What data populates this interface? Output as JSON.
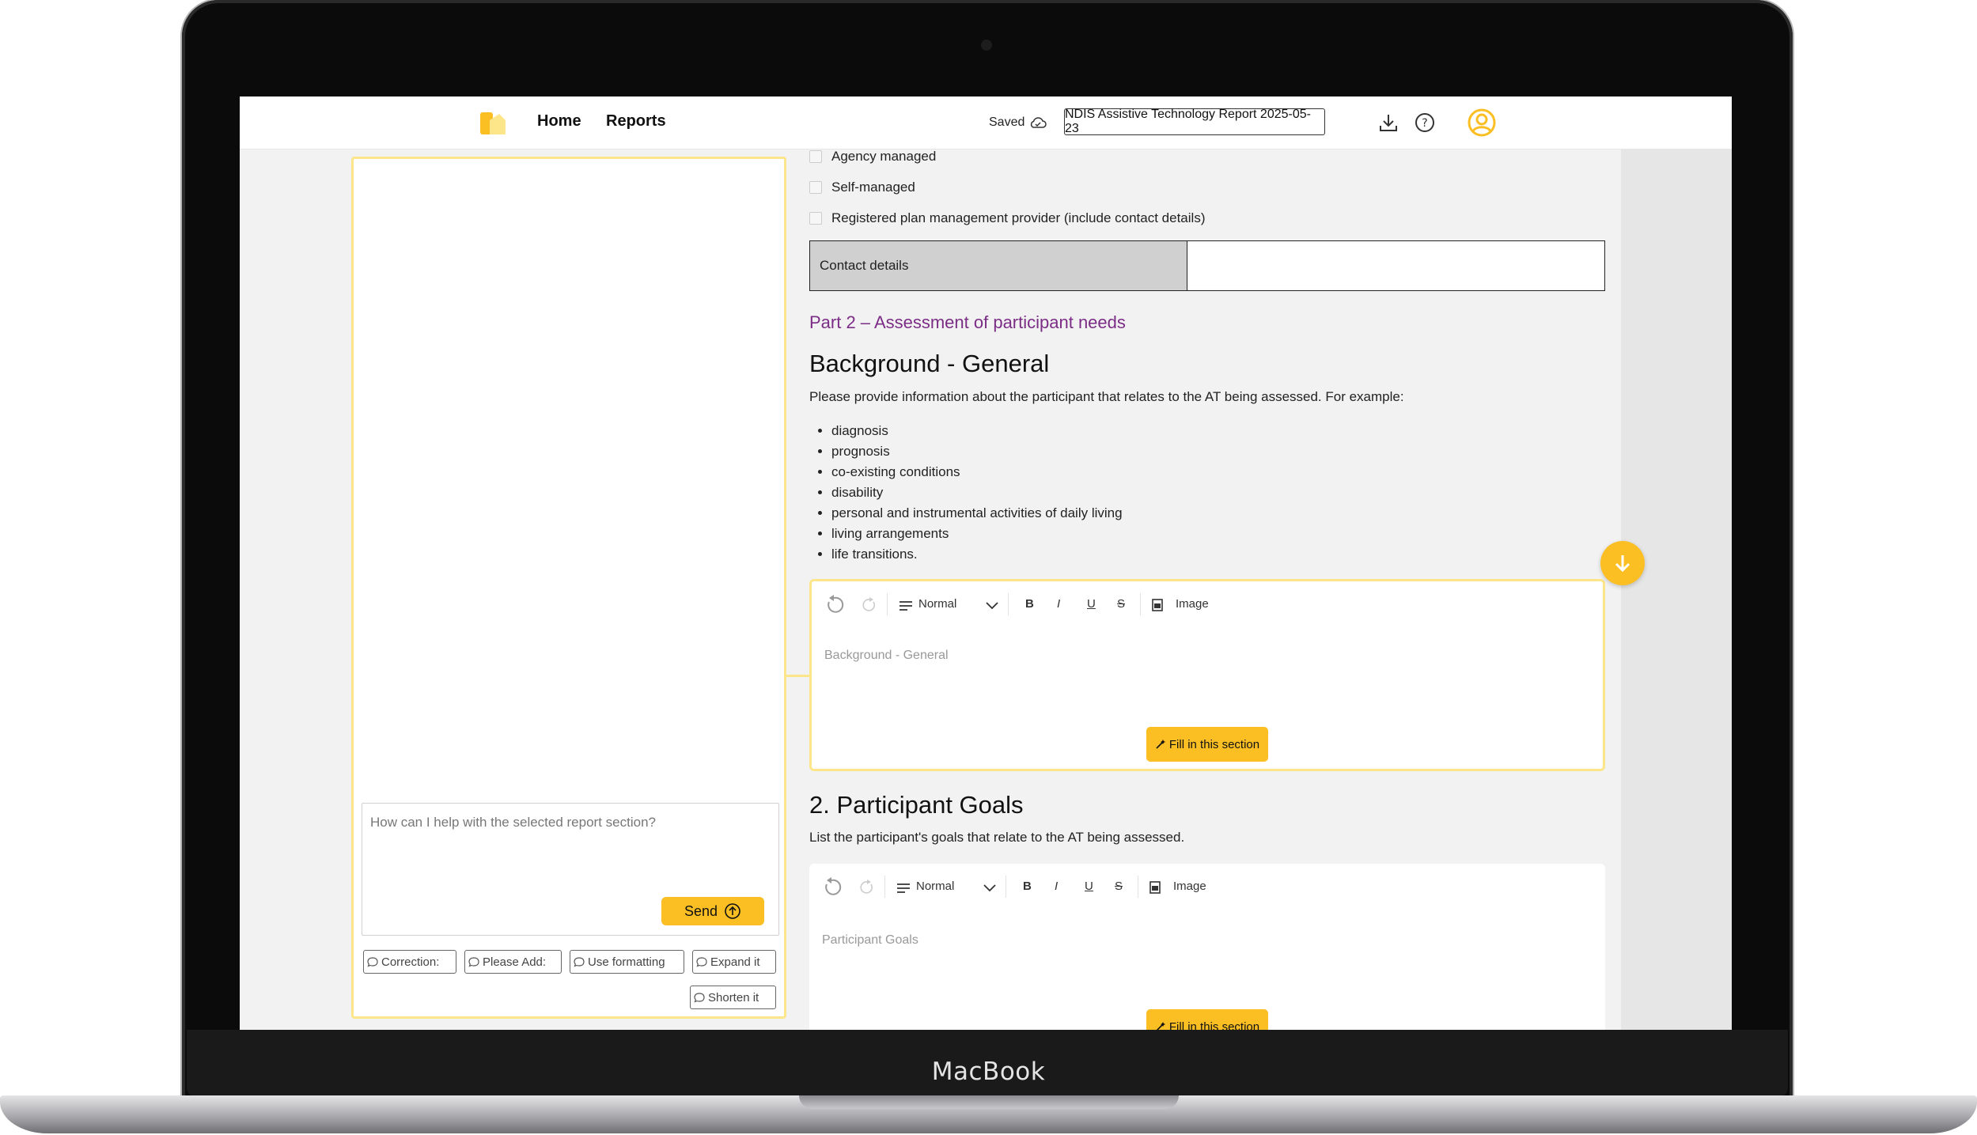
{
  "device": {
    "brand": "MacBook"
  },
  "header": {
    "nav": [
      "Home",
      "Reports"
    ],
    "saved_label": "Saved",
    "report_title": "NDIS Assistive Technology Report 2025-05-23"
  },
  "chat": {
    "placeholder": "How can I help with the selected report section?",
    "send_label": "Send",
    "chips": [
      "Correction:",
      "Please Add:",
      "Use formatting",
      "Expand it",
      "Shorten it"
    ]
  },
  "report": {
    "checkboxes": [
      "Agency managed",
      "Self-managed",
      "Registered plan management provider (include contact details)"
    ],
    "contact_label": "Contact details",
    "part_heading": "Part 2 – Assessment of participant needs",
    "background": {
      "title": "Background - General",
      "intro": "Please provide information about the participant that relates to the AT being assessed. For example:",
      "bullets": [
        "diagnosis",
        "prognosis",
        "co-existing conditions",
        "disability",
        "personal and instrumental activities of daily living",
        "living arrangements",
        "life transitions."
      ],
      "placeholder": "Background - General"
    },
    "goals": {
      "title": "2. Participant Goals",
      "intro": "List the participant's goals that relate to the AT being assessed.",
      "placeholder": "Participant Goals"
    },
    "toolbar": {
      "style_label": "Normal",
      "image_label": "Image",
      "bold": "B",
      "italic": "I",
      "underline": "U",
      "strike": "S"
    },
    "fill_label": "Fill in this section"
  },
  "colors": {
    "accent": "#fbbf24",
    "highlight_border": "#fde68a",
    "part_heading": "#7b2d86"
  }
}
